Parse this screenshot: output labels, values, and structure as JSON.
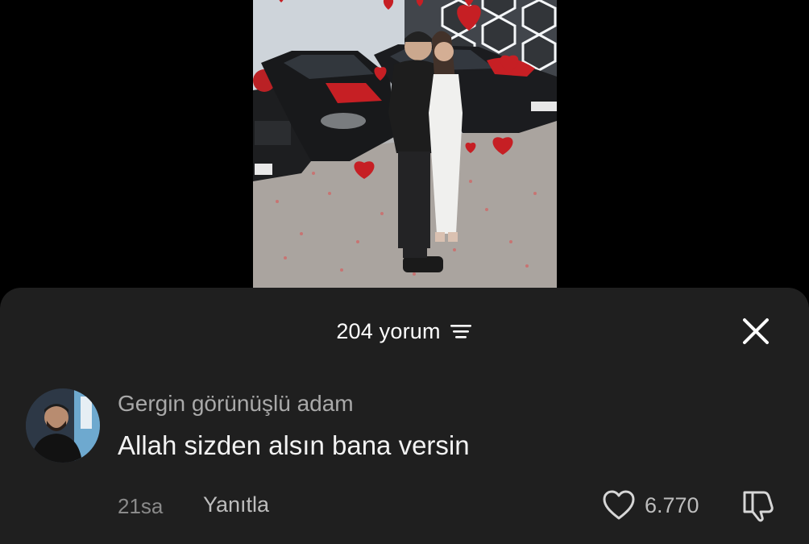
{
  "comments_panel": {
    "count_label": "204 yorum",
    "sort_icon": "filter-lines-icon",
    "close_icon": "close-x-icon"
  },
  "comment": {
    "author": "Gergin görünüşlü adam",
    "text": "Allah sizden alsın bana versin",
    "time": "21sa",
    "reply_label": "Yanıtla",
    "like_count": "6.770",
    "like_icon": "heart-outline-icon",
    "dislike_icon": "thumbs-down-icon"
  },
  "colors": {
    "sheet_background": "#1f1f1f",
    "primary_text": "#f2f2f2",
    "secondary_text": "#a9a9a9",
    "balloon_red": "#c4161c"
  }
}
